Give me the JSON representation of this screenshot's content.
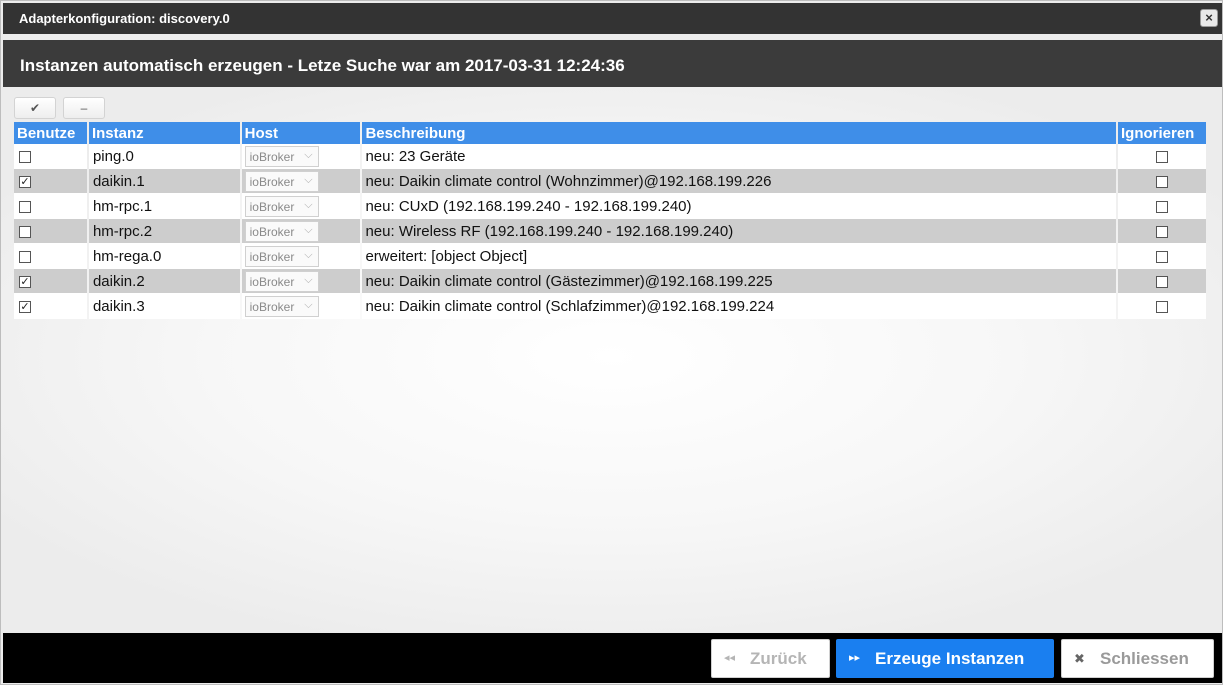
{
  "window": {
    "title": "Adapterkonfiguration: discovery.0",
    "close_icon": "×"
  },
  "header": {
    "text": "Instanzen automatisch erzeugen - Letze Suche war am 2017-03-31 12:24:36"
  },
  "toolbar": {
    "select_all_icon": "✔",
    "deselect_all_icon": "–"
  },
  "table": {
    "columns": [
      "Benutze",
      "Instanz",
      "Host",
      "Beschreibung",
      "Ignorieren"
    ],
    "rows": [
      {
        "use": "",
        "instance": "ping.0",
        "host": "ioBroker",
        "description": "neu: 23 Geräte",
        "ignore": ""
      },
      {
        "use": "✓",
        "instance": "daikin.1",
        "host": "ioBroker",
        "description": "neu: Daikin climate control (Wohnzimmer)@192.168.199.226",
        "ignore": ""
      },
      {
        "use": "",
        "instance": "hm-rpc.1",
        "host": "ioBroker",
        "description": "neu: CUxD (192.168.199.240 - 192.168.199.240)",
        "ignore": ""
      },
      {
        "use": "",
        "instance": "hm-rpc.2",
        "host": "ioBroker",
        "description": "neu: Wireless RF (192.168.199.240 - 192.168.199.240)",
        "ignore": ""
      },
      {
        "use": "",
        "instance": "hm-rega.0",
        "host": "ioBroker",
        "description": "erweitert: [object Object]",
        "ignore": ""
      },
      {
        "use": "✓",
        "instance": "daikin.2",
        "host": "ioBroker",
        "description": "neu: Daikin climate control (Gästezimmer)@192.168.199.225",
        "ignore": ""
      },
      {
        "use": "✓",
        "instance": "daikin.3",
        "host": "ioBroker",
        "description": "neu: Daikin climate control (Schlafzimmer)@192.168.199.224",
        "ignore": ""
      }
    ],
    "select_chevron": "⌵"
  },
  "footer": {
    "back_icon": "◂◂",
    "back_label": "Zurück",
    "create_icon": "▸▸",
    "create_label": "Erzeuge Instanzen",
    "close_icon": "✖",
    "close_label": "Schliessen"
  },
  "colors": {
    "titlebar": "#333333",
    "header": "#3b3b3b",
    "table_header": "#3f8ee8",
    "row_alt": "#cdcdcd",
    "primary_button": "#1a7ff0",
    "footer": "#000000"
  }
}
